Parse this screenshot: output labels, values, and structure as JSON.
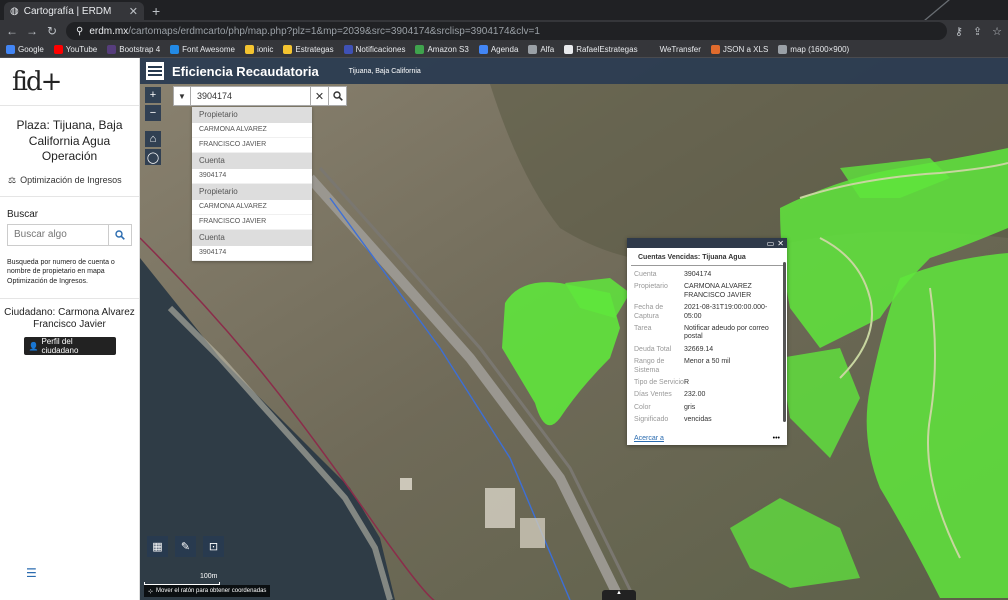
{
  "browser": {
    "tab_title": "Cartografía | ERDM",
    "url_host": "erdm.mx",
    "url_path": "/cartomaps/erdmcarto/php/map.php?plz=1&mp=2039&src=3904174&srclisp=3904174&clv=1",
    "bookmarks": [
      {
        "label": "Google",
        "color": "#4285f4"
      },
      {
        "label": "YouTube",
        "color": "#ff0000"
      },
      {
        "label": "Bootstrap 4",
        "color": "#563d7c"
      },
      {
        "label": "Font Awesome",
        "color": "#228ae6"
      },
      {
        "label": "ionic",
        "color": "#f4c430"
      },
      {
        "label": "Estrategas",
        "color": "#f4c430"
      },
      {
        "label": "Notificaciones",
        "color": "#3f51b5"
      },
      {
        "label": "Amazon S3",
        "color": "#3fa34d"
      },
      {
        "label": "Agenda",
        "color": "#4285f4"
      },
      {
        "label": "Alfa",
        "color": "#9aa0a6"
      },
      {
        "label": "RafaelEstrategas",
        "color": "#e8eaed"
      },
      {
        "label": "WeTransfer",
        "color": "#35363a"
      },
      {
        "label": "JSON a XLS",
        "color": "#e06b2d"
      },
      {
        "label": "map (1600×900)",
        "color": "#9aa0a6"
      }
    ]
  },
  "sidebar": {
    "logo": "fid+",
    "plaza": "Plaza: Tijuana, Baja California Agua Operación",
    "section": "Optimización de Ingresos",
    "buscar_label": "Buscar",
    "search_placeholder": "Buscar algo",
    "help_text": "Busqueda por numero de cuenta o nombre de propietario en mapa Optimización de Ingresos.",
    "citizen": "Ciudadano: Carmona Alvarez Francisco Javier",
    "perfil_button": "Perfil del ciudadano"
  },
  "map": {
    "title": "Eficiencia Recaudatoria",
    "subtitle": "Tijuana, Baja California",
    "search_value": "3904174",
    "results": [
      {
        "header": "Propietario",
        "items": [
          "CARMONA ALVAREZ",
          "FRANCISCO JAVIER"
        ]
      },
      {
        "header": "Cuenta",
        "items": [
          "3904174"
        ]
      },
      {
        "header": "Propietario",
        "items": [
          "CARMONA ALVAREZ",
          "FRANCISCO JAVIER"
        ]
      },
      {
        "header": "Cuenta",
        "items": [
          "3904174"
        ]
      }
    ],
    "scale_label": "100m",
    "coords_text": "Mover el ratón para obtener coordenadas"
  },
  "popup": {
    "title": "Cuentas Vencidas: Tijuana Agua",
    "rows": [
      {
        "k": "Cuenta",
        "v": "3904174"
      },
      {
        "k": "Propietario",
        "v": "CARMONA ALVAREZ FRANCISCO JAVIER"
      },
      {
        "k": "Fecha de Captura",
        "v": "2021-08-31T19:00:00.000-05:00"
      },
      {
        "k": "Tarea",
        "v": "Notificar adeudo por correo postal"
      },
      {
        "k": "Deuda Total",
        "v": "32669.14"
      },
      {
        "k": "Rango de Sistema",
        "v": "Menor a 50 mil"
      },
      {
        "k": "Tipo de Servicio",
        "v": "R"
      },
      {
        "k": "Días Ventes",
        "v": "232.00"
      },
      {
        "k": "Color",
        "v": "gris"
      },
      {
        "k": "Significado",
        "v": "vencidas"
      }
    ],
    "zoom_link": "Acercar a",
    "more": "•••"
  },
  "colors": {
    "header_bg": "#283a50",
    "parcel_green": "#5fe63c",
    "link": "#2b6cb0"
  }
}
